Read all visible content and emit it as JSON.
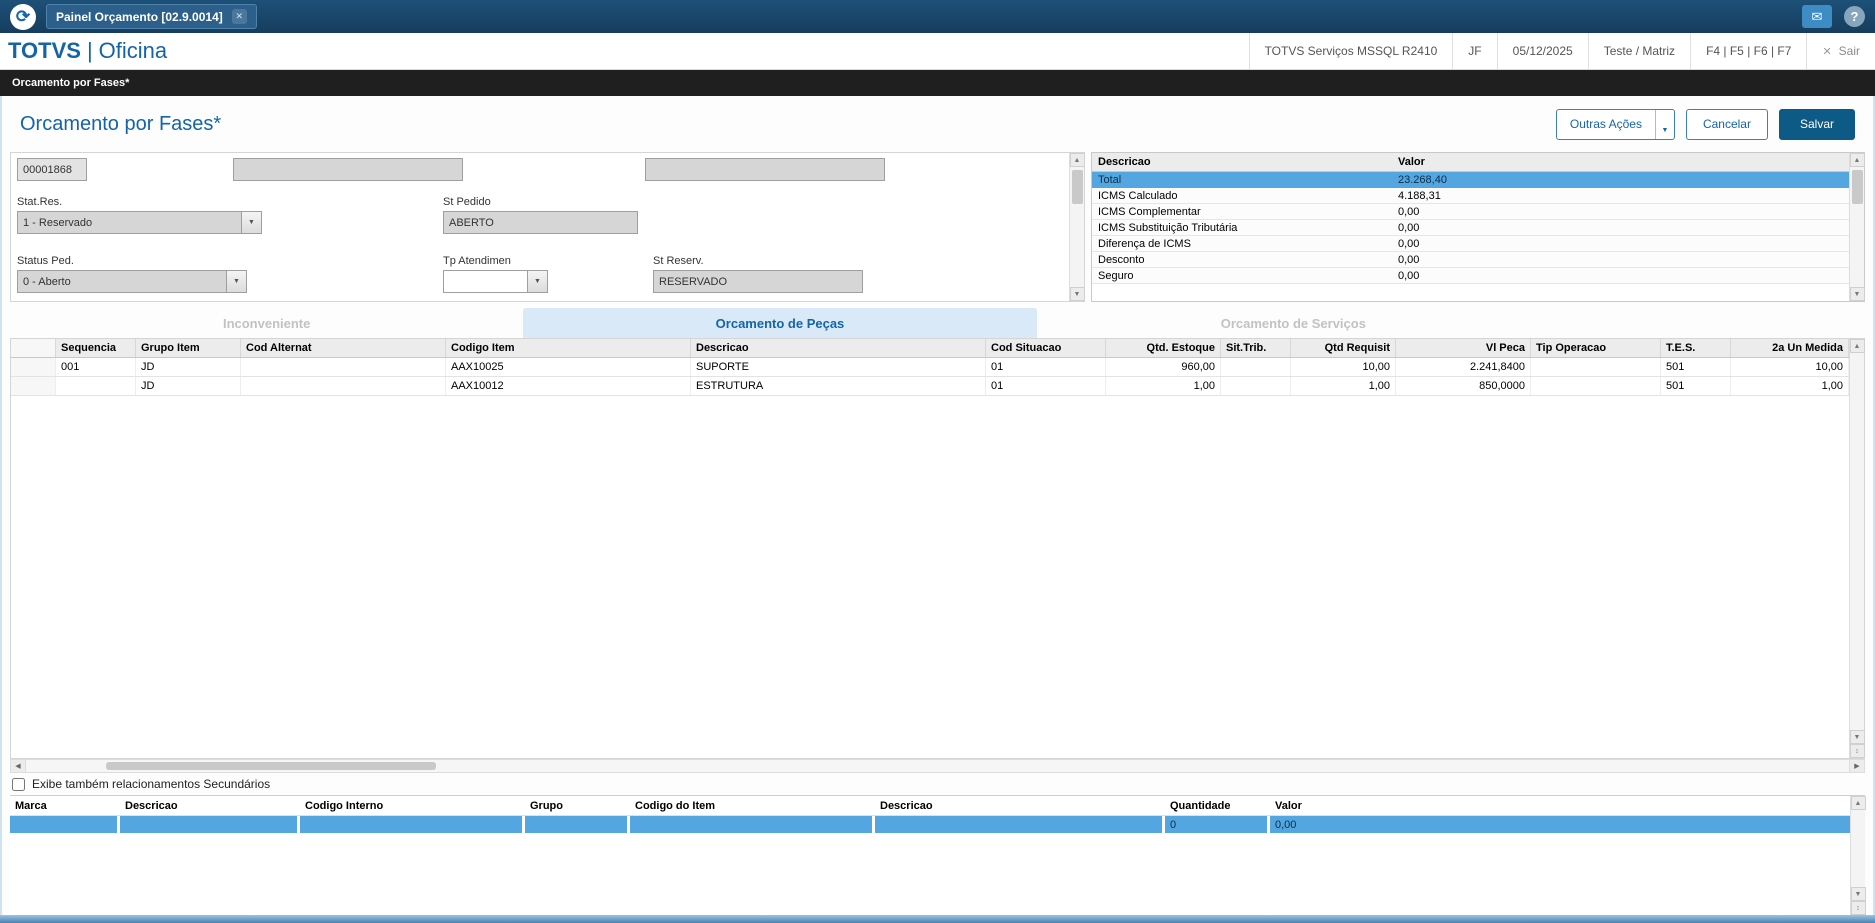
{
  "icons": {
    "logo": "⟳",
    "close": "✕",
    "mail": "✉",
    "help": "?",
    "exit": "✕",
    "caret": "▼",
    "up": "▲",
    "down": "▼",
    "left": "◀",
    "right": "▶",
    "updown": "↕"
  },
  "colors": {
    "accent": "#1464a8",
    "selection": "#54a6e0",
    "save_button": "#0e5a86",
    "topbar": "#1d5078"
  },
  "titlebar": {
    "tab_label": "Painel Orçamento [02.9.0014]"
  },
  "header": {
    "brand": "TOTVS",
    "sep": "|",
    "module": "Oficina",
    "env_items": [
      "TOTVS Serviços MSSQL R2410",
      "JF",
      "05/12/2025",
      "Teste / Matriz",
      "F4 | F5 | F6 | F7"
    ],
    "exit_label": "Sair"
  },
  "breadcrumb": {
    "label": "Orcamento por Fases*"
  },
  "page": {
    "title": "Orcamento por Fases*",
    "actions": {
      "other": "Outras Ações",
      "cancel": "Cancelar",
      "save": "Salvar"
    }
  },
  "form": {
    "order_number": "00001868",
    "stat_res": {
      "label": "Stat.Res.",
      "value": "1 - Reservado"
    },
    "st_pedido": {
      "label": "St Pedido",
      "value": "ABERTO"
    },
    "status_ped": {
      "label": "Status Ped.",
      "value": "0 - Aberto"
    },
    "tp_atendimen": {
      "label": "Tp Atendimen",
      "value": ""
    },
    "st_reserv": {
      "label": "St Reserv.",
      "value": "RESERVADO"
    }
  },
  "totals": {
    "headers": [
      "Descricao",
      "Valor"
    ],
    "rows": [
      {
        "label": "Total",
        "value": "23.268,40",
        "selected": true
      },
      {
        "label": "ICMS Calculado",
        "value": "4.188,31",
        "selected": false
      },
      {
        "label": "ICMS Complementar",
        "value": "0,00",
        "selected": false
      },
      {
        "label": "ICMS Substituição Tributária",
        "value": "0,00",
        "selected": false
      },
      {
        "label": "Diferença de ICMS",
        "value": "0,00",
        "selected": false
      },
      {
        "label": "Desconto",
        "value": "0,00",
        "selected": false
      },
      {
        "label": "Seguro",
        "value": "0,00",
        "selected": false
      }
    ]
  },
  "tabs": [
    {
      "label": "Inconveniente",
      "active": false
    },
    {
      "label": "Orcamento de Peças",
      "active": true
    },
    {
      "label": "Orcamento de Serviços",
      "active": false
    }
  ],
  "items_table": {
    "headers": [
      "Sequencia",
      "Grupo Item",
      "Cod Alternat",
      "Codigo Item",
      "Descricao",
      "Cod Situacao",
      "Qtd. Estoque",
      "Sit.Trib.",
      "Qtd Requisit",
      "Vl Peca",
      "Tip Operacao",
      "T.E.S.",
      "2a Un Medida"
    ],
    "rows": [
      [
        "001",
        "JD",
        "",
        "AAX10025",
        "SUPORTE",
        "01",
        "960,00",
        "",
        "10,00",
        "2.241,8400",
        "",
        "501",
        "10,00"
      ],
      [
        "",
        "JD",
        "",
        "AAX10012",
        "ESTRUTURA",
        "01",
        "1,00",
        "",
        "1,00",
        "850,0000",
        "",
        "501",
        "1,00"
      ]
    ]
  },
  "secondary": {
    "checkbox_label": "Exibe também relacionamentos Secundários",
    "checked": false
  },
  "related_table": {
    "headers": [
      "Marca",
      "Descricao",
      "Codigo Interno",
      "Grupo",
      "Codigo do Item",
      "Descricao",
      "Quantidade",
      "Valor"
    ],
    "rows": [
      {
        "cells": [
          "",
          "",
          "",
          "",
          "",
          "",
          "0",
          "0,00"
        ],
        "selected": true
      }
    ]
  }
}
